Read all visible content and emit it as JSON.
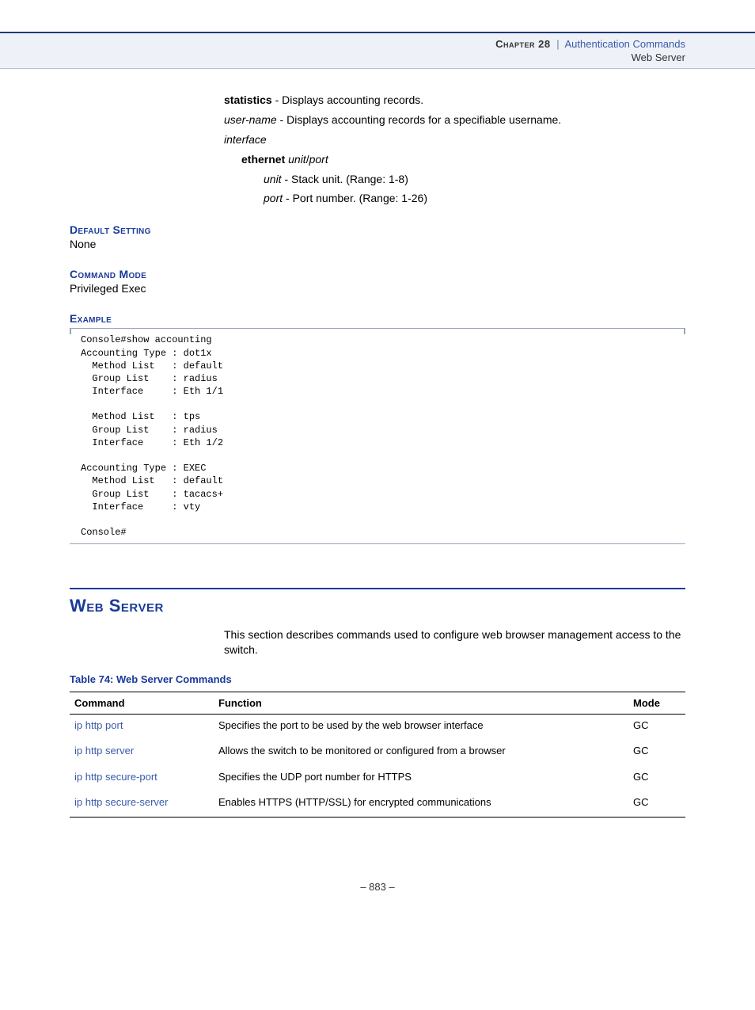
{
  "header": {
    "chapter_label": "Chapter 28",
    "separator": "|",
    "topic": "Authentication Commands",
    "subtopic": "Web Server"
  },
  "params": {
    "statistics": {
      "term": "statistics",
      "desc": " - Displays accounting records."
    },
    "user_name": {
      "term": "user-name",
      "desc": " - Displays accounting records for a specifiable username."
    },
    "interface_label": "interface",
    "ethernet_label": "ethernet",
    "unit_port_sep": "/",
    "unit_term": "unit",
    "port_term": "port",
    "unit_desc": " - Stack unit. (Range: 1-8)",
    "port_desc": " - Port number. (Range: 1-26)"
  },
  "default_setting": {
    "heading": "Default Setting",
    "value": "None"
  },
  "command_mode": {
    "heading": "Command Mode",
    "value": "Privileged Exec"
  },
  "example": {
    "heading": "Example",
    "code": "Console#show accounting\nAccounting Type : dot1x\n  Method List   : default\n  Group List    : radius\n  Interface     : Eth 1/1\n\n  Method List   : tps\n  Group List    : radius\n  Interface     : Eth 1/2\n\nAccounting Type : EXEC\n  Method List   : default\n  Group List    : tacacs+\n  Interface     : vty\n\nConsole#"
  },
  "section": {
    "heading": "Web Server",
    "intro": "This section describes commands used to configure web browser management access to the switch."
  },
  "table": {
    "caption": "Table 74: Web Server Commands",
    "headers": {
      "command": "Command",
      "function": "Function",
      "mode": "Mode"
    },
    "rows": [
      {
        "command": "ip http port",
        "function": "Specifies the port to be used by the web browser interface",
        "mode": "GC"
      },
      {
        "command": "ip http server",
        "function": "Allows the switch to be monitored or configured from a browser",
        "mode": "GC"
      },
      {
        "command": "ip http secure-port",
        "function": "Specifies the UDP port number for HTTPS",
        "mode": "GC"
      },
      {
        "command": "ip http secure-server",
        "function": "Enables HTTPS (HTTP/SSL) for encrypted communications",
        "mode": "GC"
      }
    ]
  },
  "footer": {
    "page": "– 883 –"
  }
}
